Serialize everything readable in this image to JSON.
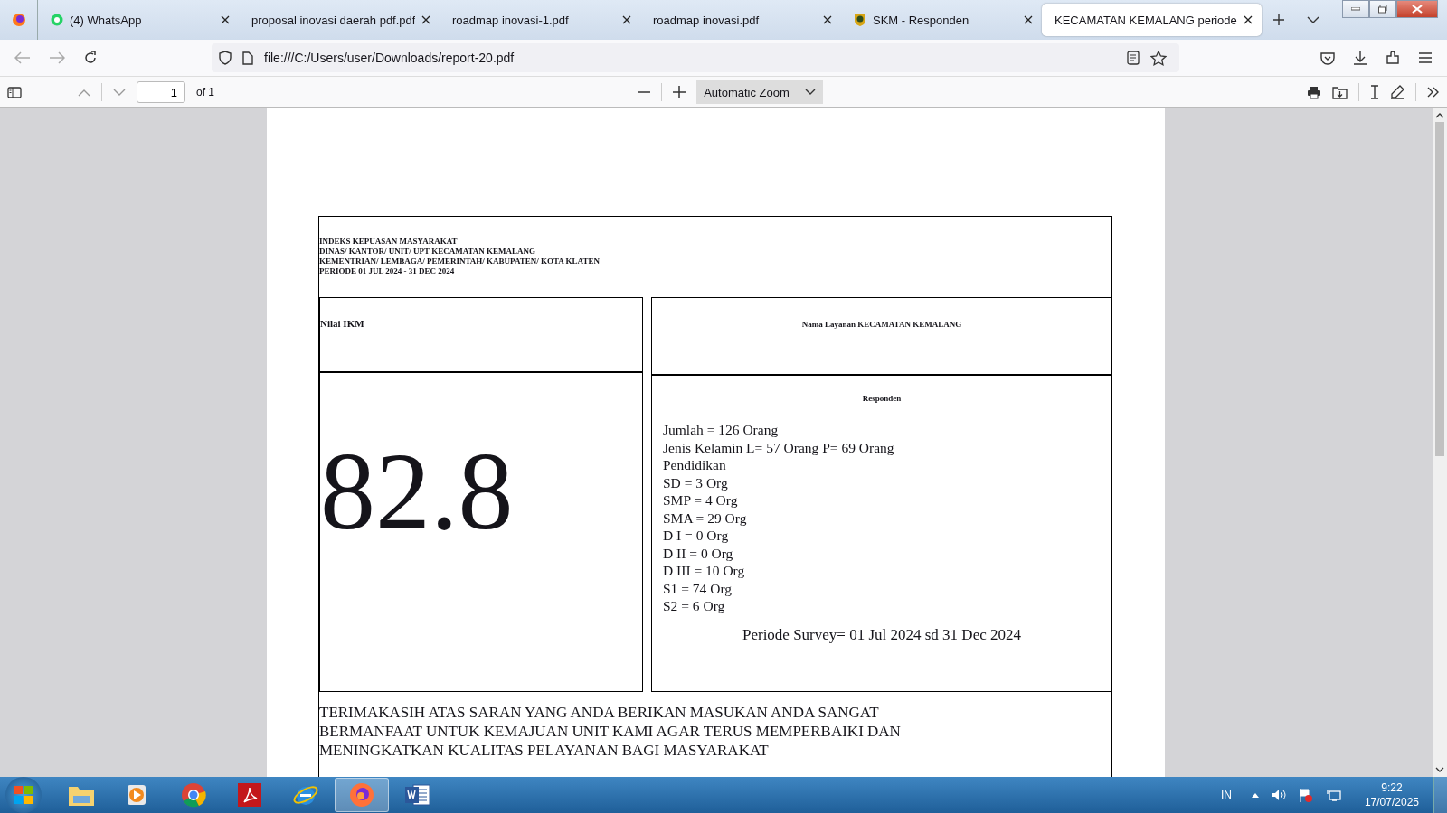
{
  "tabs": [
    {
      "label": "(4) WhatsApp",
      "selected": false,
      "kind": "chat"
    },
    {
      "label": "proposal inovasi daerah pdf.pdf",
      "selected": false,
      "kind": "plain"
    },
    {
      "label": "roadmap inovasi-1.pdf",
      "selected": false,
      "kind": "plain"
    },
    {
      "label": "roadmap inovasi.pdf",
      "selected": false,
      "kind": "plain"
    },
    {
      "label": "SKM - Responden",
      "selected": false,
      "kind": "emblem"
    },
    {
      "label": "KECAMATAN KEMALANG periode",
      "selected": true,
      "kind": "plain"
    }
  ],
  "address": "file:///C:/Users/user/Downloads/report-20.pdf",
  "pdf_toolbar": {
    "page": "1",
    "page_count": "of 1",
    "zoom": "Automatic Zoom"
  },
  "document": {
    "header": [
      "INDEKS KEPUASAN MASYARAKAT",
      "DINAS/ KANTOR/ UNIT/ UPT KECAMATAN KEMALANG",
      "KEMENTRIAN/ LEMBAGA/ PEMERINTAH/ KABUPATEN/ KOTA KLATEN",
      "PERIODE 01 JUL 2024 - 31 DEC 2024"
    ],
    "score_label": "Nilai IKM",
    "service_label": "Nama Layanan KECAMATAN KEMALANG",
    "score": "82.8",
    "respondents_title": "Responden",
    "respondents": [
      "Jumlah = 126 Orang",
      "Jenis Kelamin L= 57 Orang P= 69 Orang",
      "Pendidikan",
      "SD = 3 Org",
      "SMP = 4 Org",
      "SMA = 29 Org",
      "D I = 0 Org",
      "D II = 0 Org",
      "D III = 10 Org",
      "S1 = 74 Org",
      "S2 = 6 Org"
    ],
    "survey_period": "Periode Survey= 01 Jul 2024 sd 31 Dec 2024",
    "closing": [
      "TERIMAKASIH ATAS SARAN YANG ANDA BERIKAN MASUKAN ANDA SANGAT",
      "BERMANFAAT UNTUK KEMAJUAN UNIT KAMI AGAR TERUS MEMPERBAIKI DAN",
      "MENINGKATKAN KUALITAS PELAYANAN BAGI MASYARAKAT"
    ]
  },
  "taskbar": {
    "apps": [
      {
        "kind": "folder",
        "selected": false
      },
      {
        "kind": "media",
        "selected": false
      },
      {
        "kind": "chrome",
        "selected": false
      },
      {
        "kind": "acrobat",
        "selected": false
      },
      {
        "kind": "ie",
        "selected": false
      },
      {
        "kind": "firefox",
        "selected": true
      },
      {
        "kind": "word",
        "selected": false
      }
    ],
    "language": "IN",
    "time": "9:22",
    "date": "17/07/2025"
  }
}
